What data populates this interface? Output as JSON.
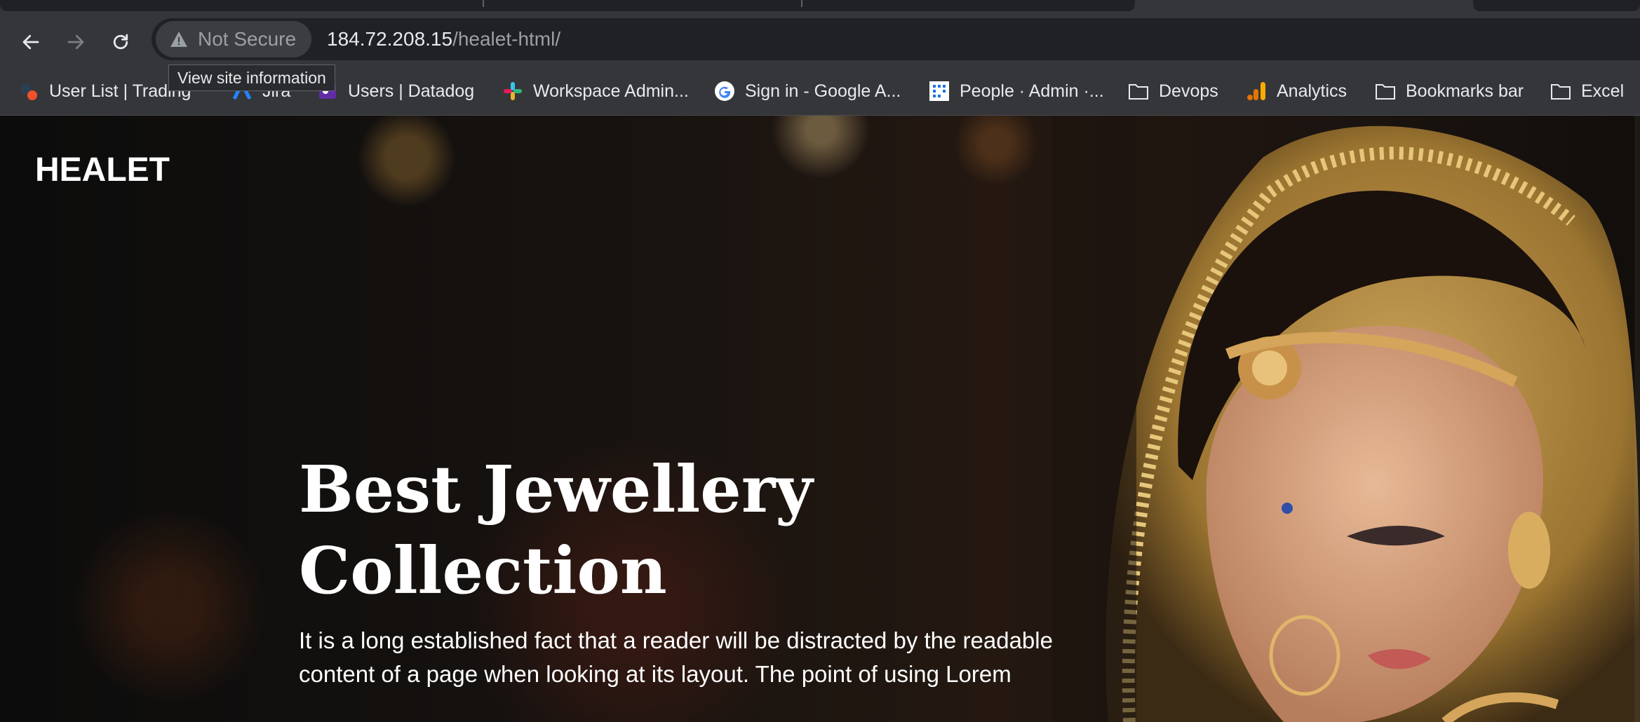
{
  "browser": {
    "security_chip": {
      "label": "Not Secure",
      "icon": "warning-triangle-icon"
    },
    "url": {
      "host": "184.72.208.15",
      "path": "/healet-html/"
    },
    "tooltip": "View site information",
    "colors": {
      "toolbar": "#35363a",
      "omnibox": "#202124",
      "text": "#e8eaed",
      "muted": "#9aa0a6"
    }
  },
  "bookmarks": [
    {
      "label": "User List | Trading",
      "icon": "trading-app-icon"
    },
    {
      "label": "Jira",
      "icon": "jira-icon"
    },
    {
      "label": "Users | Datadog",
      "icon": "datadog-icon"
    },
    {
      "label": "Workspace Admin...",
      "icon": "slack-icon"
    },
    {
      "label": "Sign in - Google A...",
      "icon": "google-icon"
    },
    {
      "label": "People · Admin ·...",
      "icon": "admin-grid-icon"
    },
    {
      "label": "Devops",
      "icon": "folder-icon"
    },
    {
      "label": "Analytics",
      "icon": "analytics-icon"
    },
    {
      "label": "Bookmarks bar",
      "icon": "folder-icon"
    },
    {
      "label": "Excel",
      "icon": "folder-icon"
    }
  ],
  "site": {
    "brand": "HEALET",
    "hero": {
      "title_line1": "Best Jewellery",
      "title_line2": "Collection",
      "text": "It is a long established fact that a reader will be distracted by the readable content of a page when looking at its layout. The point of using Lorem"
    }
  }
}
